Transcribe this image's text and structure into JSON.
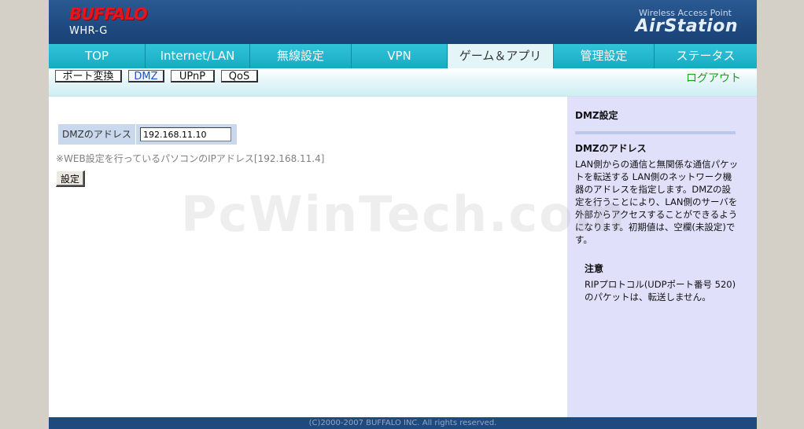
{
  "header": {
    "brand": "BUFFALO",
    "model": "WHR-G",
    "tagline": "Wireless Access Point",
    "product": "AirStation"
  },
  "tabs": [
    {
      "label": "TOP"
    },
    {
      "label": "Internet/LAN"
    },
    {
      "label": "無線設定"
    },
    {
      "label": "VPN"
    },
    {
      "label": "ゲーム＆アプリ",
      "active": true
    },
    {
      "label": "管理設定"
    },
    {
      "label": "ステータス"
    }
  ],
  "subtabs": [
    {
      "label": "ポート変換"
    },
    {
      "label": "DMZ",
      "active": true
    },
    {
      "label": "UPnP"
    },
    {
      "label": "QoS"
    }
  ],
  "logout_label": "ログアウト",
  "form": {
    "dmz_label": "DMZのアドレス",
    "dmz_value": "192.168.11.10",
    "note": "※WEB設定を行っているパソコンのIPアドレス[192.168.11.4]",
    "submit_label": "設定"
  },
  "watermark": "PcWinTech.com",
  "help": {
    "title": "DMZ設定",
    "section_title": "DMZのアドレス",
    "section_body": "LAN側からの通信と無関係な通信パケットを転送する LAN側のネットワーク機器のアドレスを指定します。DMZの設定を行うことにより、LAN側のサーバを外部からアクセスすることができるようになります。初期値は、空欄(未設定)です。",
    "note_title": "注意",
    "note_body": "RIPプロトコル(UDPポート番号 520)のパケットは、転送しません。"
  },
  "footer": "(C)2000-2007 BUFFALO INC. All rights reserved.",
  "colors": {
    "header_bg": "#1e4a80",
    "tab_bg": "#1cb0c8",
    "active_tab_bg": "#e4f5f8",
    "brand_red": "#e8131b",
    "help_bg": "#e0e0fa",
    "label_bg": "#c9d8ec",
    "logout_green": "#1aa020"
  }
}
